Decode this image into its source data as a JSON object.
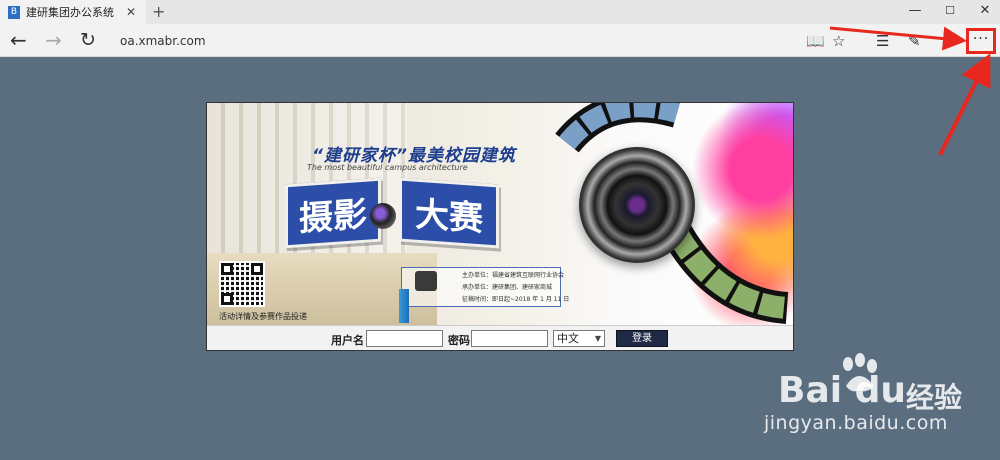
{
  "browser": {
    "tab_title": "建研集团办公系统",
    "tab_favicon": "B",
    "tab_close": "✕",
    "new_tab": "+",
    "address": "oa.xmabr.com",
    "more": "···"
  },
  "banner": {
    "slogan": "“建研家杯”最美校园建筑",
    "subtitle": "The most beautiful campus architecture",
    "title_left": "摄影",
    "title_right": "大赛",
    "qr_caption": "活动详情及参赛作品投递",
    "info": {
      "host": "主办单位：福建省建筑互联网行业协会",
      "organizer": "承办单位：建研集团、建研家商城",
      "period": "征稿时间：即日起~2018 年 1 月 11 日"
    }
  },
  "login": {
    "username_label": "用户名",
    "username_value": "",
    "password_label": "密码",
    "password_value": "",
    "language_selected": "中文",
    "login_button": "登录"
  },
  "watermark": {
    "logo": "Bai  du",
    "cn": "经验",
    "url": "jingyan.baidu.com"
  },
  "colors": {
    "page_bg": "#5b6e80",
    "highlight": "#e8281e",
    "title_blue": "#2c4ea8"
  }
}
